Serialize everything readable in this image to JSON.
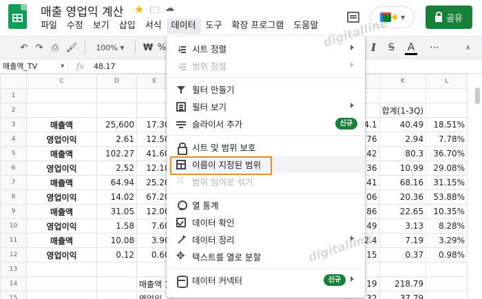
{
  "app": {
    "doc_title": "매출 영업익 계산",
    "share_label": "공유"
  },
  "menubar": {
    "items": [
      "파일",
      "수정",
      "보기",
      "삽입",
      "서식",
      "데이터",
      "도구",
      "확장 프로그램",
      "도움말"
    ],
    "active": "데이터"
  },
  "toolbar": {
    "zoom": "100%",
    "currency": "₩",
    "percent": "%",
    "italic": "I",
    "strike": "S",
    "text_color": "A",
    "more": "⋯",
    "collapse": "∧"
  },
  "formula_bar": {
    "name_box": "매출액_TV",
    "fx": "fx",
    "value": "48.17"
  },
  "grid": {
    "column_headers": [
      "C",
      "D",
      "E",
      "",
      "",
      "",
      "",
      "",
      "K",
      "L"
    ],
    "rows": [
      {
        "n": "1",
        "c": "",
        "d": "",
        "e": "",
        "j": "",
        "k": "",
        "l": ""
      },
      {
        "n": "2",
        "c": "",
        "d": "",
        "e": "",
        "j": "",
        "k": "합계(1-3Q)",
        "l": ""
      },
      {
        "n": "3",
        "c": "매출액",
        "d": "25,600",
        "e": "17.30",
        "j": "4.1",
        "k": "40.49",
        "l": "18.51%"
      },
      {
        "n": "4",
        "c": "영업이익",
        "d": "2.61",
        "e": "12.50",
        "j": "76",
        "k": "2.94",
        "l": "7.78%"
      },
      {
        "n": "5",
        "c": "매출액",
        "d": "102.27",
        "e": "41.60",
        "j": "42",
        "k": "80.3",
        "l": "36.70%"
      },
      {
        "n": "6",
        "c": "영업이익",
        "d": "2.52",
        "e": "12.10",
        "j": "36",
        "k": "10.99",
        "l": "29.08%"
      },
      {
        "n": "7",
        "c": "매출액",
        "d": "64.94",
        "e": "25.20",
        "j": "41",
        "k": "68.16",
        "l": "31.15%"
      },
      {
        "n": "8",
        "c": "영업이익",
        "d": "14.02",
        "e": "67.20",
        "j": "06",
        "k": "20.36",
        "l": "53.88%"
      },
      {
        "n": "9",
        "c": "매출액",
        "d": "31.05",
        "e": "12.00",
        "j": "86",
        "k": "22.65",
        "l": "10.35%"
      },
      {
        "n": "10",
        "c": "영업이익",
        "d": "1.58",
        "e": "7.60",
        "j": "49",
        "k": "3.13",
        "l": "8.28%"
      },
      {
        "n": "11",
        "c": "매출액",
        "d": "10.08",
        "e": "3.90",
        "j": "2.4",
        "k": "7.19",
        "l": "3.29%"
      },
      {
        "n": "12",
        "c": "영업이익",
        "d": "0.12",
        "e": "0.60",
        "j": "15",
        "k": "0.37",
        "l": "0.98%"
      },
      {
        "n": "13",
        "c": "",
        "d": "",
        "e": "",
        "j": "",
        "k": "",
        "l": ""
      },
      {
        "n": "14",
        "c": "",
        "d": "",
        "e": "매출액 1",
        "j": "19",
        "k": "218.79",
        "l": ""
      },
      {
        "n": "15",
        "c": "",
        "d": "",
        "e": "영업익",
        "j": "32",
        "k": "37.79",
        "l": ""
      }
    ]
  },
  "data_menu": {
    "items": [
      {
        "label": "시트 정렬",
        "icon": "sort-icon",
        "submenu": true,
        "disabled": false
      },
      {
        "label": "범위 정렬",
        "icon": "sort-icon",
        "submenu": true,
        "disabled": true
      },
      {
        "label": "필터 만들기",
        "icon": "filter-icon",
        "submenu": false,
        "disabled": false
      },
      {
        "label": "필터 보기",
        "icon": "filter-view-icon",
        "submenu": true,
        "disabled": false
      },
      {
        "label": "슬라이서 추가",
        "icon": "slicer-icon",
        "submenu": false,
        "disabled": false,
        "badge": "신규"
      },
      {
        "label": "시트 및 범위 보호",
        "icon": "lock-icon",
        "submenu": false,
        "disabled": false
      },
      {
        "label": "이름이 지정된 범위",
        "icon": "named-range-icon",
        "submenu": false,
        "disabled": false
      },
      {
        "label": "범위 임의로 섞기",
        "icon": "shuffle-icon",
        "submenu": false,
        "disabled": true
      },
      {
        "label": "열 통계",
        "icon": "bulb-icon",
        "submenu": false,
        "disabled": false
      },
      {
        "label": "데이터 확인",
        "icon": "validation-icon",
        "submenu": false,
        "disabled": false
      },
      {
        "label": "데이터 정리",
        "icon": "wand-icon",
        "submenu": true,
        "disabled": false
      },
      {
        "label": "텍스트를 열로 분할",
        "icon": "split-icon",
        "submenu": false,
        "disabled": false
      },
      {
        "label": "데이터 커넥터",
        "icon": "database-icon",
        "submenu": true,
        "disabled": false,
        "badge": "신규"
      }
    ]
  },
  "watermarks": [
    "digitalline",
    "digitalline"
  ],
  "colors": {
    "accent_green": "#188038",
    "highlight_border": "#f28a22",
    "sheets_green": "#0f9d58"
  }
}
